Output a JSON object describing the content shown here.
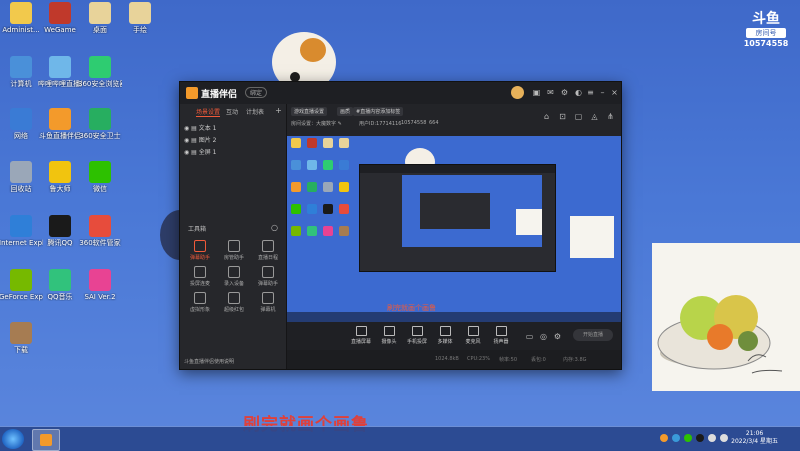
{
  "desktop": {
    "icons": [
      {
        "label": "Administ...",
        "color": "#f2c94c"
      },
      {
        "label": "WeGame",
        "color": "#c0392b"
      },
      {
        "label": "桌面",
        "color": "#e8d39a"
      },
      {
        "label": "手绘",
        "color": "#e8d39a"
      },
      {
        "label": "计算机",
        "color": "#4a90d9"
      },
      {
        "label": "哔哩哔哩直播姬",
        "color": "#6fb7e9"
      },
      {
        "label": "360安全浏览器",
        "color": "#2ecc71"
      },
      {
        "label": "网络",
        "color": "#3a7bd5"
      },
      {
        "label": "斗鱼直播伴侣",
        "color": "#f39a2b"
      },
      {
        "label": "360安全卫士",
        "color": "#27ae60"
      },
      {
        "label": "回收站",
        "color": "#9aa7b8"
      },
      {
        "label": "鲁大师",
        "color": "#f1c40f"
      },
      {
        "label": "微信",
        "color": "#2dc100"
      },
      {
        "label": "Internet Explorer",
        "color": "#2f7fd8"
      },
      {
        "label": "腾讯QQ",
        "color": "#1a1a1a"
      },
      {
        "label": "360软件管家",
        "color": "#e74c3c"
      },
      {
        "label": "GeForce Experience",
        "color": "#76b900"
      },
      {
        "label": "QQ音乐",
        "color": "#31c27c"
      },
      {
        "label": "SAI Ver.2",
        "color": "#e84393"
      },
      {
        "label": "下载",
        "color": "#a67c52"
      }
    ]
  },
  "app": {
    "title": "直播伴侣",
    "version": "绑定",
    "left_tabs": [
      "场景设置",
      "互动",
      "计划表"
    ],
    "sources": [
      "文本 1",
      "图片 2",
      "全屏 1"
    ],
    "tools_title": "工具箱",
    "tools": [
      {
        "label": "弹幕助手",
        "red": true
      },
      {
        "label": "房管助手",
        "red": false
      },
      {
        "label": "直播日程",
        "red": false
      },
      {
        "label": "投屏连麦",
        "red": false
      },
      {
        "label": "录入设备",
        "red": false
      },
      {
        "label": "弹幕助手",
        "red": false
      },
      {
        "label": "虚拟形象",
        "red": false
      },
      {
        "label": "超级红包",
        "red": false
      },
      {
        "label": "弹幕机",
        "red": false
      }
    ],
    "notice": "斗鱼直播伴侣使用说明",
    "header": {
      "chip1": "游戏直播设置",
      "chip2": "画质",
      "chip3": "#直播内容添加标签",
      "room_label": "房间设置：",
      "room_value": "大魔数字",
      "id_text": "用户ID:17714116",
      "fans": "10574558",
      "hot": "664"
    },
    "preview_caption": "刷完就画个画鲁",
    "bottom": [
      "直播屏幕",
      "摄像头",
      "手机投屏",
      "多媒体",
      "麦克风",
      "扬声器"
    ],
    "stop_button": "开始直播",
    "status": [
      "1024.8kB",
      "CPU:23%",
      "帧率:50",
      "丢包:0",
      "内存:3.8G"
    ]
  },
  "watermark": {
    "logo": "斗鱼",
    "label": "房间号",
    "room": "10574558"
  },
  "caption": "刷完就画个画鲁",
  "taskbar": {
    "time": "21:06",
    "date": "2022/3/4 星期五"
  }
}
